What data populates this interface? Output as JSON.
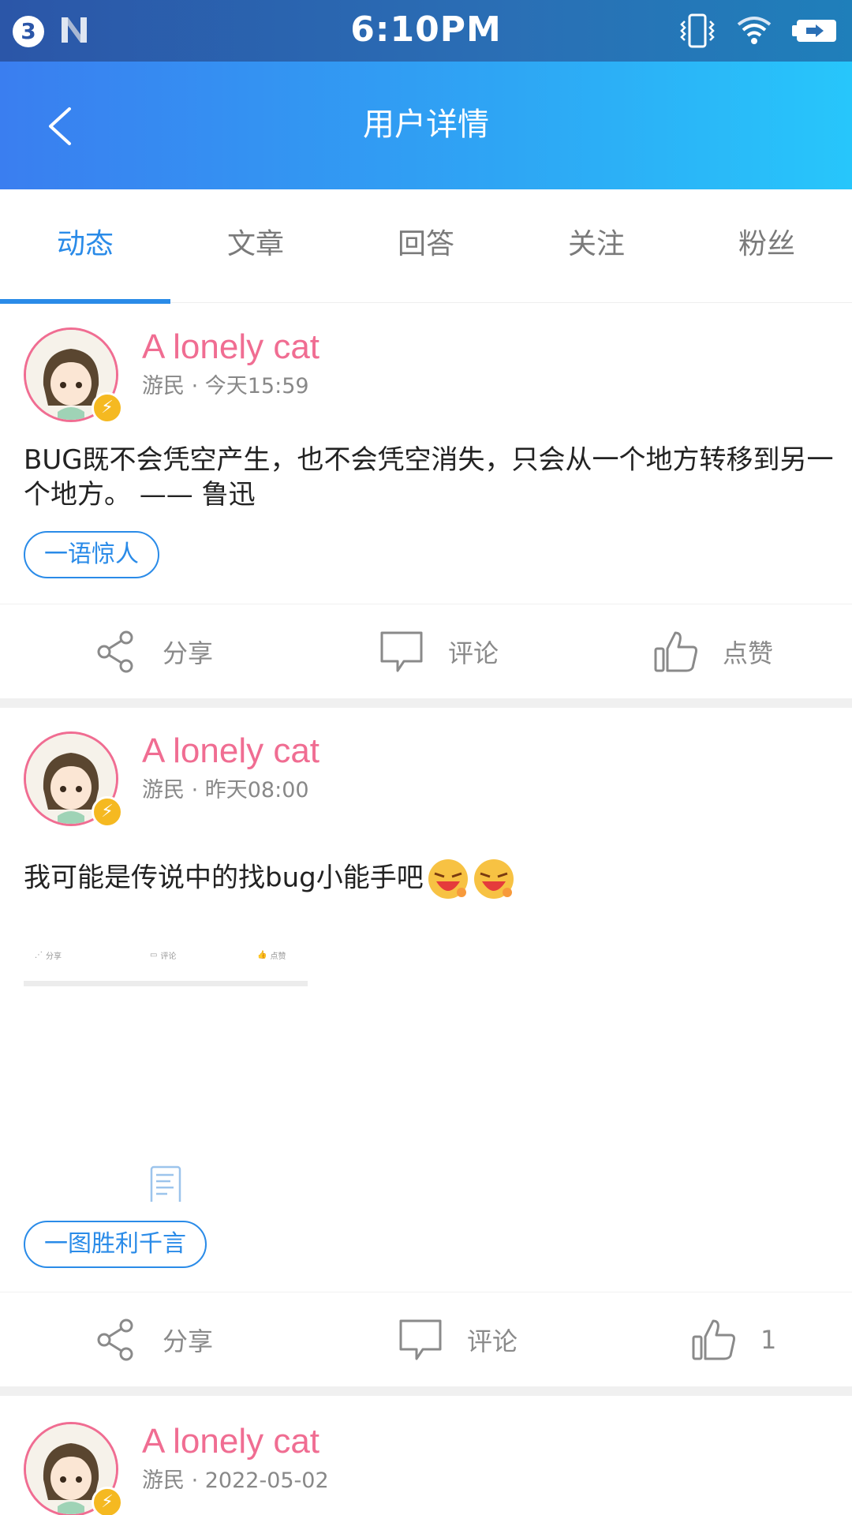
{
  "status_bar": {
    "badge": "3",
    "time": "6:10PM",
    "icons": [
      "vibrate-icon",
      "wifi-icon",
      "battery-charging-icon"
    ]
  },
  "header": {
    "title": "用户详情",
    "back_icon": "chevron-left-icon"
  },
  "tabs": [
    {
      "label": "动态",
      "active": true
    },
    {
      "label": "文章",
      "active": false
    },
    {
      "label": "回答",
      "active": false
    },
    {
      "label": "关注",
      "active": false
    },
    {
      "label": "粉丝",
      "active": false
    }
  ],
  "posts": [
    {
      "user": "A lonely cat",
      "meta": "游民 · 今天15:59",
      "content": "BUG既不会凭空产生，也不会凭空消失，只会从一个地方转移到另一个地方。 —— 鲁迅",
      "tag": "一语惊人",
      "actions": {
        "share": "分享",
        "comment": "评论",
        "like": "点赞"
      }
    },
    {
      "user": "A lonely cat",
      "meta": "游民 · 昨天08:00",
      "content": "我可能是传说中的找bug小能手吧",
      "emoji_count": 2,
      "preview": {
        "share": "分享",
        "comment": "评论",
        "like": "点赞"
      },
      "tag": "一图胜利千言",
      "actions": {
        "share": "分享",
        "comment": "评论",
        "like": "1"
      }
    },
    {
      "user": "A lonely cat",
      "meta": "游民 · 2022-05-02"
    }
  ],
  "colors": {
    "accent": "#2a8be8",
    "username": "#f06d92",
    "header_start": "#3a7ef0",
    "header_end": "#27c6fb"
  }
}
